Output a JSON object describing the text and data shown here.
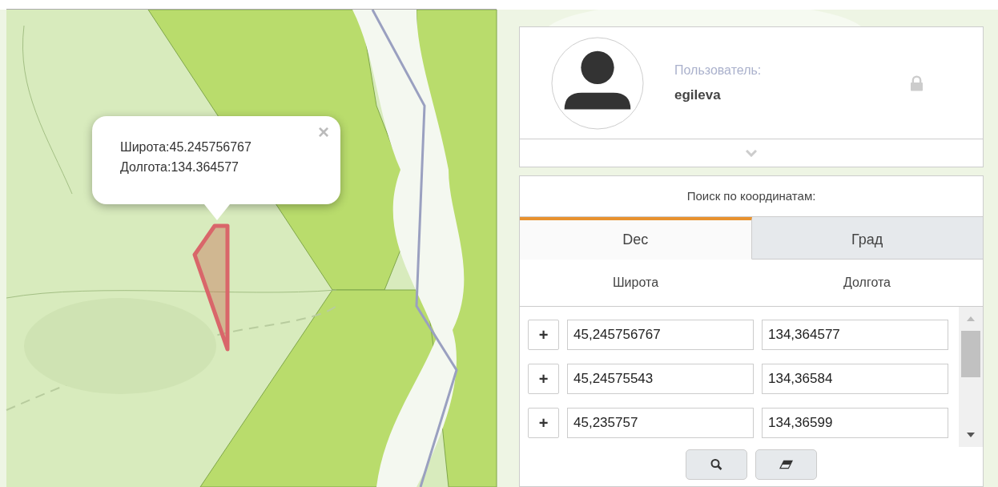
{
  "popup": {
    "close": "×",
    "lines": [
      "Широта:45.245756767",
      "Долгота:134.364577"
    ]
  },
  "user": {
    "label": "Пользователь:",
    "name": "egileva"
  },
  "search": {
    "title": "Поиск по координатам:",
    "tabs": [
      {
        "label": "Dec",
        "selected": true
      },
      {
        "label": "Град",
        "selected": false
      }
    ],
    "columns": [
      "Широта",
      "Долгота"
    ],
    "rows": [
      {
        "add": "+",
        "lat": "45,245756767",
        "lon": "134,364577"
      },
      {
        "add": "+",
        "lat": "45,24575543",
        "lon": "134,36584"
      },
      {
        "add": "+",
        "lat": "45,235757",
        "lon": "134,36599"
      }
    ]
  }
}
